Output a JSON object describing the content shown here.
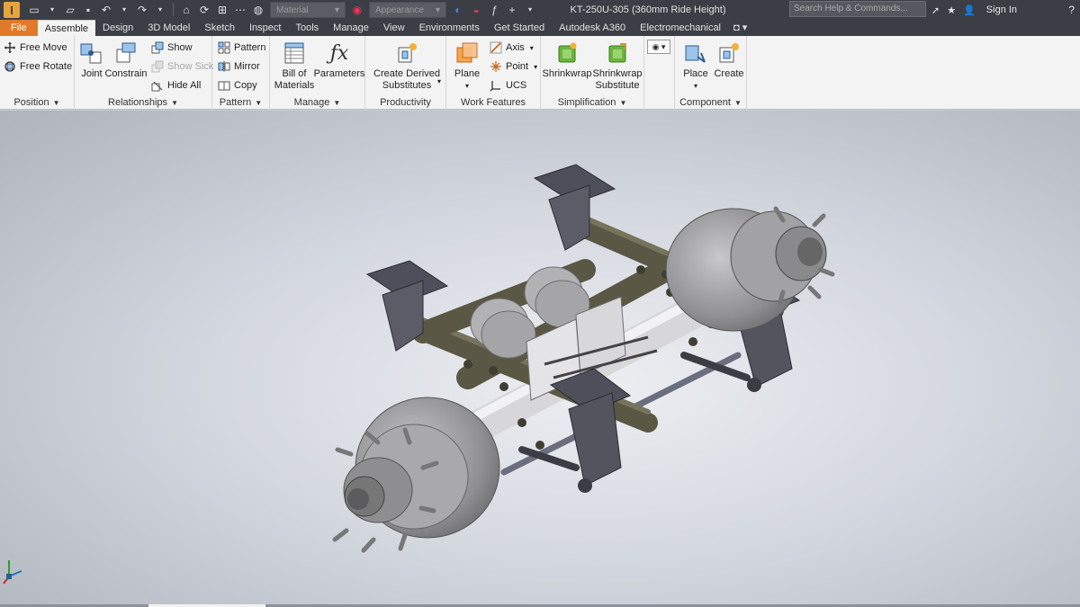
{
  "app": {
    "title": "KT-250U-305 (360mm Ride Height)",
    "search_placeholder": "Search Help & Commands...",
    "signin": "Sign In",
    "material_combo": "Material",
    "appearance_combo": "Appearance",
    "logo_letter": "I"
  },
  "tabs": [
    "File",
    "Assemble",
    "Design",
    "3D Model",
    "Sketch",
    "Inspect",
    "Tools",
    "Manage",
    "View",
    "Environments",
    "Get Started",
    "Autodesk A360",
    "Electromechanical"
  ],
  "active_tab": "Assemble",
  "ribbon": {
    "position": {
      "label": "Position",
      "free_move": "Free Move",
      "free_rotate": "Free Rotate"
    },
    "relationships": {
      "label": "Relationships",
      "joint": "Joint",
      "constrain": "Constrain",
      "show": "Show",
      "show_sick": "Show Sick",
      "hide_all": "Hide All"
    },
    "pattern": {
      "label": "Pattern",
      "pattern": "Pattern",
      "mirror": "Mirror",
      "copy": "Copy"
    },
    "manage": {
      "label": "Manage",
      "bom_line1": "Bill of",
      "bom_line2": "Materials",
      "parameters": "Parameters"
    },
    "productivity": {
      "label": "Productivity",
      "line1": "Create Derived",
      "line2": "Substitutes"
    },
    "work_features": {
      "label": "Work Features",
      "plane": "Plane",
      "axis": "Axis",
      "point": "Point",
      "ucs": "UCS"
    },
    "simplification": {
      "label": "Simplification",
      "shrinkwrap": "Shrinkwrap",
      "sub_line1": "Shrinkwrap",
      "sub_line2": "Substitute"
    },
    "component": {
      "label": "Component",
      "place": "Place",
      "create": "Create"
    }
  },
  "colors": {
    "titlebar": "#3b3f45",
    "file_tab": "#e07a2a",
    "ribbon_bg": "#f3f3f3",
    "axle_body": "#5f5b48",
    "drum": "#9a9a9c",
    "bracket": "#4e4f5a"
  },
  "icons": [
    "inventor-logo",
    "new-icon",
    "open-icon",
    "save-icon",
    "undo-icon",
    "redo-icon",
    "home-icon",
    "update-icon",
    "measure-icon",
    "globe-icon",
    "color-wheel-icon",
    "appearance-icon",
    "fx-icon",
    "plus-icon",
    "help-icon",
    "star-icon",
    "user-icon"
  ]
}
